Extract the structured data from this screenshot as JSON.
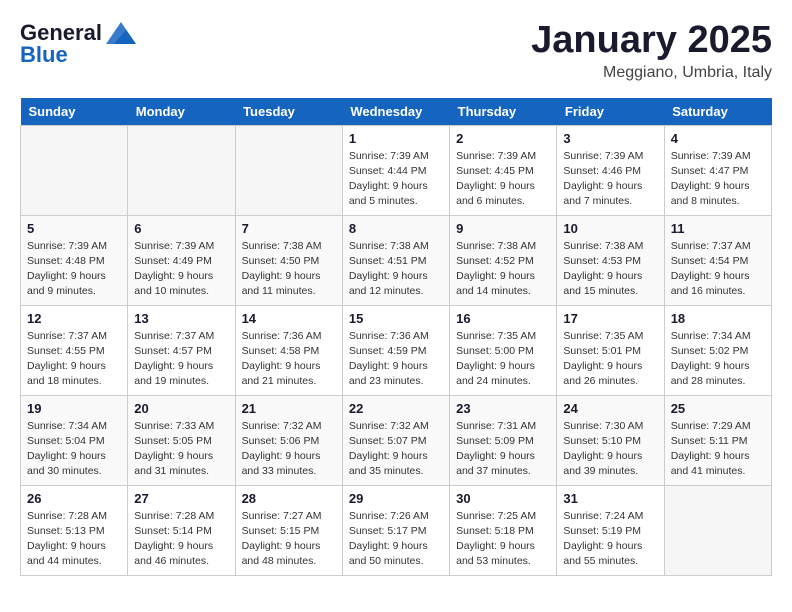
{
  "header": {
    "logo_line1": "General",
    "logo_line2": "Blue",
    "month": "January 2025",
    "location": "Meggiano, Umbria, Italy"
  },
  "weekdays": [
    "Sunday",
    "Monday",
    "Tuesday",
    "Wednesday",
    "Thursday",
    "Friday",
    "Saturday"
  ],
  "weeks": [
    [
      {
        "day": "",
        "info": ""
      },
      {
        "day": "",
        "info": ""
      },
      {
        "day": "",
        "info": ""
      },
      {
        "day": "1",
        "info": "Sunrise: 7:39 AM\nSunset: 4:44 PM\nDaylight: 9 hours\nand 5 minutes."
      },
      {
        "day": "2",
        "info": "Sunrise: 7:39 AM\nSunset: 4:45 PM\nDaylight: 9 hours\nand 6 minutes."
      },
      {
        "day": "3",
        "info": "Sunrise: 7:39 AM\nSunset: 4:46 PM\nDaylight: 9 hours\nand 7 minutes."
      },
      {
        "day": "4",
        "info": "Sunrise: 7:39 AM\nSunset: 4:47 PM\nDaylight: 9 hours\nand 8 minutes."
      }
    ],
    [
      {
        "day": "5",
        "info": "Sunrise: 7:39 AM\nSunset: 4:48 PM\nDaylight: 9 hours\nand 9 minutes."
      },
      {
        "day": "6",
        "info": "Sunrise: 7:39 AM\nSunset: 4:49 PM\nDaylight: 9 hours\nand 10 minutes."
      },
      {
        "day": "7",
        "info": "Sunrise: 7:38 AM\nSunset: 4:50 PM\nDaylight: 9 hours\nand 11 minutes."
      },
      {
        "day": "8",
        "info": "Sunrise: 7:38 AM\nSunset: 4:51 PM\nDaylight: 9 hours\nand 12 minutes."
      },
      {
        "day": "9",
        "info": "Sunrise: 7:38 AM\nSunset: 4:52 PM\nDaylight: 9 hours\nand 14 minutes."
      },
      {
        "day": "10",
        "info": "Sunrise: 7:38 AM\nSunset: 4:53 PM\nDaylight: 9 hours\nand 15 minutes."
      },
      {
        "day": "11",
        "info": "Sunrise: 7:37 AM\nSunset: 4:54 PM\nDaylight: 9 hours\nand 16 minutes."
      }
    ],
    [
      {
        "day": "12",
        "info": "Sunrise: 7:37 AM\nSunset: 4:55 PM\nDaylight: 9 hours\nand 18 minutes."
      },
      {
        "day": "13",
        "info": "Sunrise: 7:37 AM\nSunset: 4:57 PM\nDaylight: 9 hours\nand 19 minutes."
      },
      {
        "day": "14",
        "info": "Sunrise: 7:36 AM\nSunset: 4:58 PM\nDaylight: 9 hours\nand 21 minutes."
      },
      {
        "day": "15",
        "info": "Sunrise: 7:36 AM\nSunset: 4:59 PM\nDaylight: 9 hours\nand 23 minutes."
      },
      {
        "day": "16",
        "info": "Sunrise: 7:35 AM\nSunset: 5:00 PM\nDaylight: 9 hours\nand 24 minutes."
      },
      {
        "day": "17",
        "info": "Sunrise: 7:35 AM\nSunset: 5:01 PM\nDaylight: 9 hours\nand 26 minutes."
      },
      {
        "day": "18",
        "info": "Sunrise: 7:34 AM\nSunset: 5:02 PM\nDaylight: 9 hours\nand 28 minutes."
      }
    ],
    [
      {
        "day": "19",
        "info": "Sunrise: 7:34 AM\nSunset: 5:04 PM\nDaylight: 9 hours\nand 30 minutes."
      },
      {
        "day": "20",
        "info": "Sunrise: 7:33 AM\nSunset: 5:05 PM\nDaylight: 9 hours\nand 31 minutes."
      },
      {
        "day": "21",
        "info": "Sunrise: 7:32 AM\nSunset: 5:06 PM\nDaylight: 9 hours\nand 33 minutes."
      },
      {
        "day": "22",
        "info": "Sunrise: 7:32 AM\nSunset: 5:07 PM\nDaylight: 9 hours\nand 35 minutes."
      },
      {
        "day": "23",
        "info": "Sunrise: 7:31 AM\nSunset: 5:09 PM\nDaylight: 9 hours\nand 37 minutes."
      },
      {
        "day": "24",
        "info": "Sunrise: 7:30 AM\nSunset: 5:10 PM\nDaylight: 9 hours\nand 39 minutes."
      },
      {
        "day": "25",
        "info": "Sunrise: 7:29 AM\nSunset: 5:11 PM\nDaylight: 9 hours\nand 41 minutes."
      }
    ],
    [
      {
        "day": "26",
        "info": "Sunrise: 7:28 AM\nSunset: 5:13 PM\nDaylight: 9 hours\nand 44 minutes."
      },
      {
        "day": "27",
        "info": "Sunrise: 7:28 AM\nSunset: 5:14 PM\nDaylight: 9 hours\nand 46 minutes."
      },
      {
        "day": "28",
        "info": "Sunrise: 7:27 AM\nSunset: 5:15 PM\nDaylight: 9 hours\nand 48 minutes."
      },
      {
        "day": "29",
        "info": "Sunrise: 7:26 AM\nSunset: 5:17 PM\nDaylight: 9 hours\nand 50 minutes."
      },
      {
        "day": "30",
        "info": "Sunrise: 7:25 AM\nSunset: 5:18 PM\nDaylight: 9 hours\nand 53 minutes."
      },
      {
        "day": "31",
        "info": "Sunrise: 7:24 AM\nSunset: 5:19 PM\nDaylight: 9 hours\nand 55 minutes."
      },
      {
        "day": "",
        "info": ""
      }
    ]
  ]
}
